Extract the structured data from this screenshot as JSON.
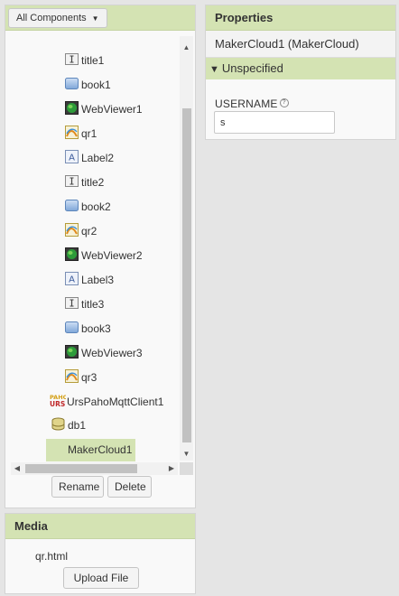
{
  "components": {
    "filter_label": "All Components",
    "items": [
      {
        "label": "title1",
        "icon": "textbox-icon"
      },
      {
        "label": "book1",
        "icon": "button-icon"
      },
      {
        "label": "WebViewer1",
        "icon": "globe-icon"
      },
      {
        "label": "qr1",
        "icon": "barcode-scanner-icon"
      },
      {
        "label": "Label2",
        "icon": "label-icon"
      },
      {
        "label": "title2",
        "icon": "textbox-icon"
      },
      {
        "label": "book2",
        "icon": "button-icon"
      },
      {
        "label": "qr2",
        "icon": "barcode-scanner-icon"
      },
      {
        "label": "WebViewer2",
        "icon": "globe-icon"
      },
      {
        "label": "Label3",
        "icon": "label-icon"
      },
      {
        "label": "title3",
        "icon": "textbox-icon"
      },
      {
        "label": "book3",
        "icon": "button-icon"
      },
      {
        "label": "WebViewer3",
        "icon": "globe-icon"
      },
      {
        "label": "qr3",
        "icon": "barcode-scanner-icon"
      },
      {
        "label": "UrsPahoMqttClient1",
        "icon": "paho-mqtt-icon"
      },
      {
        "label": "db1",
        "icon": "database-icon"
      },
      {
        "label": "MakerCloud1",
        "icon": "none",
        "selected": true
      }
    ],
    "rename_label": "Rename",
    "delete_label": "Delete"
  },
  "media": {
    "title": "Media",
    "files": [
      "qr.html"
    ],
    "upload_label": "Upload File ..."
  },
  "properties": {
    "title": "Properties",
    "component": "MakerCloud1 (MakerCloud)",
    "group": "Unspecified",
    "field_label": "USERNAME",
    "help": "?",
    "field_value": "s"
  },
  "colors": {
    "header_green": "#d4e3b3",
    "background": "#e5e5e5"
  }
}
